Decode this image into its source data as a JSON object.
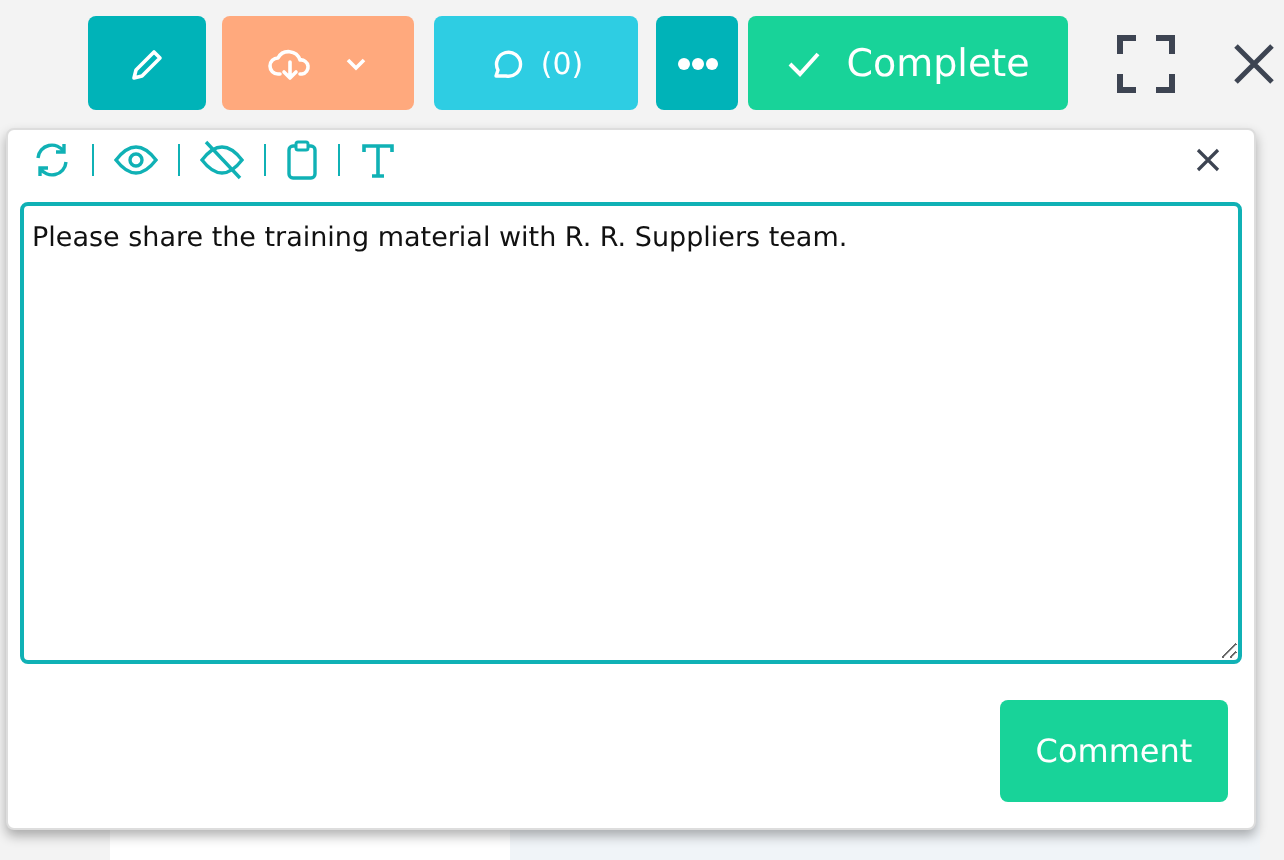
{
  "toolbar": {
    "comments_label": "(0)",
    "complete_label": "Complete"
  },
  "comment_popup": {
    "text": "Please share the training material with R. R. Suppliers team.",
    "submit": "Comment"
  }
}
